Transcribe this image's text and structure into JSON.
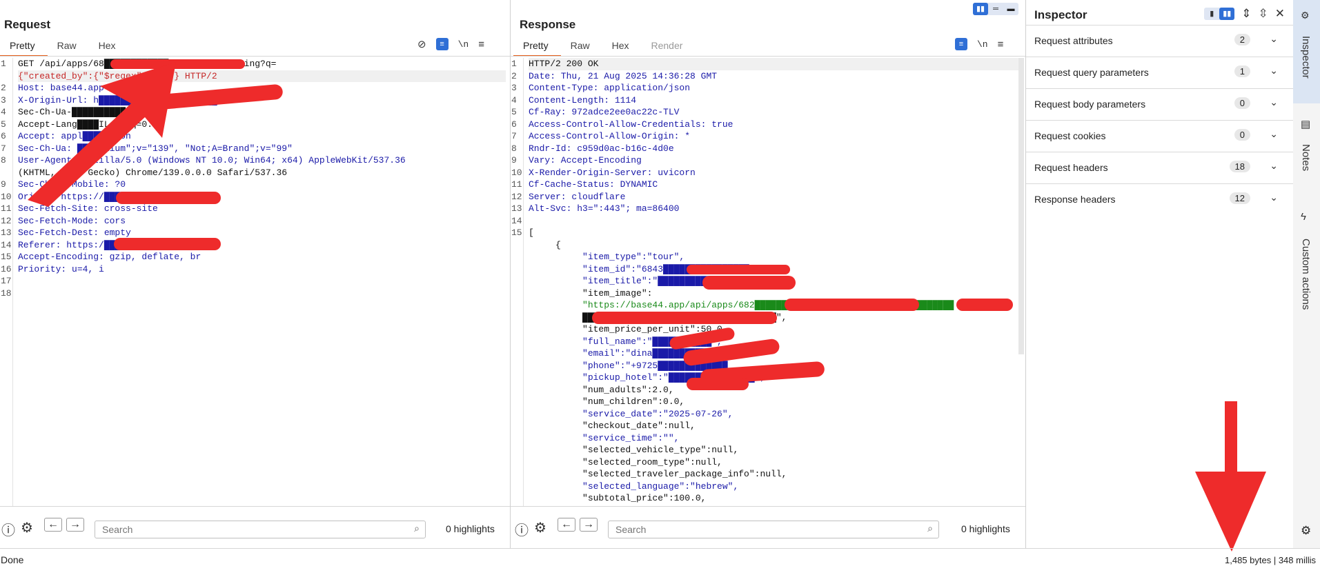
{
  "request": {
    "title": "Request",
    "tabs": [
      "Pretty",
      "Raw",
      "Hex"
    ],
    "lines": [
      "GET /api/apps/68████████████/entities/Booking?q=",
      "{\"created_by\":{\"$regex\":\"^H\"}} HTTP/2",
      "Host: base44.app",
      "X-Origin-Url: h██████████████████████Home",
      "Sec-Ch-Ua-██████████",
      "Accept-Lang████IL,he;q=0.9",
      "Accept: appl████/json",
      "Sec-Ch-Ua: █████mium\";v=\"139\", \"Not;A=Brand\";v=\"99\"",
      "User-Agent: Mozilla/5.0 (Windows NT 10.0; Win64; x64) AppleWebKit/537.36",
      "(KHTML, like Gecko) Chrome/139.0.0.0 Safari/537.36",
      "Sec-Ch-Ua-Mobile: ?0",
      "Origin: https://██████████████com",
      "Sec-Fetch-Site: cross-site",
      "Sec-Fetch-Mode: cors",
      "Sec-Fetch-Dest: empty",
      "Referer: https:/███████████████n.com/",
      "Accept-Encoding: gzip, deflate, br",
      "Priority: u=4, i",
      "",
      ""
    ],
    "line_numbers": [
      "1",
      "",
      "2",
      "3",
      "4",
      "5",
      "6",
      "7",
      "8",
      "",
      "9",
      "10",
      "11",
      "12",
      "13",
      "14",
      "15",
      "16",
      "17",
      "18"
    ],
    "search_placeholder": "Search",
    "highlights": "0 highlights"
  },
  "response": {
    "title": "Response",
    "tabs": [
      "Pretty",
      "Raw",
      "Hex",
      "Render"
    ],
    "lines": [
      "HTTP/2 200 OK",
      "Date: Thu, 21 Aug 2025 14:36:28 GMT",
      "Content-Type: application/json",
      "Content-Length: 1114",
      "Cf-Ray: 972adce2ee0ac22c-TLV",
      "Access-Control-Allow-Credentials: true",
      "Access-Control-Allow-Origin: *",
      "Rndr-Id: c959d0ac-b16c-4d0e",
      "Vary: Accept-Encoding",
      "X-Render-Origin-Server: uvicorn",
      "Cf-Cache-Status: DYNAMIC",
      "Server: cloudflare",
      "Alt-Svc: h3=\":443\"; ma=86400",
      "",
      "[",
      "     {",
      "          \"item_type\":\"tour\",",
      "          \"item_id\":\"6843████████████████74\",",
      "          \"item_title\":\"█████████████\",",
      "          \"item_image\":",
      "          \"https://base44.app/api/apps/682█████████████████████/files/█████████",
      "          ████████████████████████████████████\",",
      "          \"item_price_per_unit\":50.0,",
      "          \"full_name\":\"███████████\",",
      "          \"email\":\"dina██████████",
      "          \"phone\":\"+9725█████████████",
      "          \"pickup_hotel\":\"████████████████\",",
      "          \"num_adults\":2.0,",
      "          \"num_children\":0.0,",
      "          \"service_date\":\"2025-07-26\",",
      "          \"checkout_date\":null,",
      "          \"service_time\":\"\",",
      "          \"selected_vehicle_type\":null,",
      "          \"selected_room_type\":null,",
      "          \"selected_traveler_package_info\":null,",
      "          \"selected_language\":\"hebrew\",",
      "          \"subtotal_price\":100.0,"
    ],
    "line_numbers": [
      "1",
      "2",
      "3",
      "4",
      "5",
      "6",
      "7",
      "8",
      "9",
      "10",
      "11",
      "12",
      "13",
      "14",
      "15",
      "",
      "",
      "",
      "",
      "",
      "",
      "",
      "",
      "",
      "",
      "",
      "",
      "",
      "",
      "",
      "",
      "",
      "",
      "",
      "",
      "",
      ""
    ],
    "search_placeholder": "Search",
    "highlights": "0 highlights"
  },
  "inspector": {
    "title": "Inspector",
    "rows": [
      {
        "label": "Request attributes",
        "count": "2"
      },
      {
        "label": "Request query parameters",
        "count": "1"
      },
      {
        "label": "Request body parameters",
        "count": "0"
      },
      {
        "label": "Request cookies",
        "count": "0"
      },
      {
        "label": "Request headers",
        "count": "18"
      },
      {
        "label": "Response headers",
        "count": "12"
      }
    ]
  },
  "side_tabs": [
    "Inspector",
    "Notes",
    "Custom actions"
  ],
  "status": {
    "left": "Done",
    "right": "1,485 bytes | 348 millis"
  },
  "colors": {
    "accent": "#e8601c",
    "toggle_blue": "#2f6fd6",
    "annotation_red": "#ee2b2b",
    "key_blue": "#1a1aa8",
    "string_green": "#1a8a1a"
  }
}
